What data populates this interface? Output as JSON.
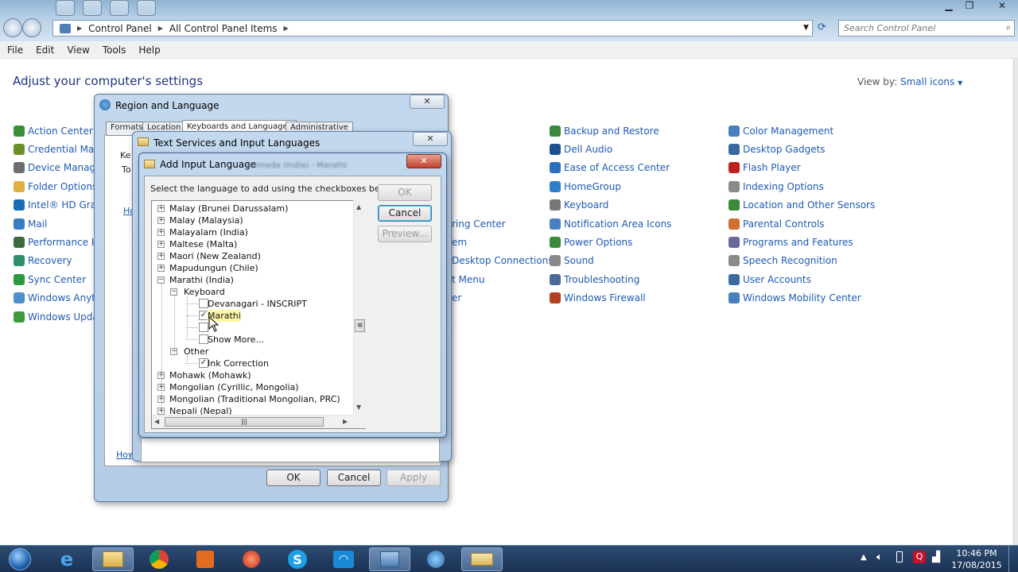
{
  "explorer": {
    "address": [
      "Control Panel",
      "All Control Panel Items"
    ],
    "search_placeholder": "Search Control Panel",
    "menu": [
      "File",
      "Edit",
      "View",
      "Tools",
      "Help"
    ],
    "title": "Adjust your computer's settings",
    "view_by_label": "View by:",
    "view_by_value": "Small icons",
    "col1": [
      {
        "label": "Action Center",
        "color": "#3c8c3c"
      },
      {
        "label": "Credential Mana",
        "color": "#6b8f2a"
      },
      {
        "label": "Device Manager",
        "color": "#6d6d6d"
      },
      {
        "label": "Folder Options",
        "color": "#e0b040"
      },
      {
        "label": "Intel® HD Graph",
        "color": "#1a6db5"
      },
      {
        "label": "Mail",
        "color": "#3b7dc4"
      },
      {
        "label": "Performance Info",
        "color": "#3a6b3a"
      },
      {
        "label": "Recovery",
        "color": "#2f8f6f"
      },
      {
        "label": "Sync Center",
        "color": "#2b9a3c"
      },
      {
        "label": "Windows Anytim",
        "color": "#4f8fcf"
      },
      {
        "label": "Windows Update",
        "color": "#3e9a3e"
      }
    ],
    "col2": [
      {
        "label": "ring Center"
      },
      {
        "label": "em"
      },
      {
        "label": "Desktop Connections"
      },
      {
        "label": "t Menu"
      },
      {
        "label": "er"
      }
    ],
    "col3": [
      {
        "label": "Backup and Restore",
        "color": "#3a8a3a"
      },
      {
        "label": "Dell Audio",
        "color": "#1e4f8f"
      },
      {
        "label": "Ease of Access Center",
        "color": "#2f6fbf"
      },
      {
        "label": "HomeGroup",
        "color": "#2f7fcf"
      },
      {
        "label": "Keyboard",
        "color": "#777777"
      },
      {
        "label": "Notification Area Icons",
        "color": "#4a7fbf"
      },
      {
        "label": "Power Options",
        "color": "#3a8a3a"
      },
      {
        "label": "Sound",
        "color": "#8a8a8a"
      },
      {
        "label": "Troubleshooting",
        "color": "#4a6a9a"
      },
      {
        "label": "Windows Firewall",
        "color": "#b04020"
      }
    ],
    "col4": [
      {
        "label": "Color Management",
        "color": "#4a7fbf"
      },
      {
        "label": "Desktop Gadgets",
        "color": "#3a6aa0"
      },
      {
        "label": "Flash Player",
        "color": "#c02020"
      },
      {
        "label": "Indexing Options",
        "color": "#8a8a8a"
      },
      {
        "label": "Location and Other Sensors",
        "color": "#3a8a3a"
      },
      {
        "label": "Parental Controls",
        "color": "#d07030"
      },
      {
        "label": "Programs and Features",
        "color": "#6a6a9a"
      },
      {
        "label": "Speech Recognition",
        "color": "#8a8a8a"
      },
      {
        "label": "User Accounts",
        "color": "#3a6aa0"
      },
      {
        "label": "Windows Mobility Center",
        "color": "#4a7fbf"
      }
    ]
  },
  "region_dialog": {
    "title": "Region and Language",
    "tabs": [
      "Formats",
      "Location",
      "Keyboards and Languages",
      "Administrative"
    ],
    "partial_texts": [
      "Ke",
      "To",
      "Ho",
      "How"
    ],
    "buttons": {
      "ok": "OK",
      "cancel": "Cancel",
      "apply": "Apply"
    }
  },
  "text_services_dialog": {
    "title": "Text Services and Input Languages",
    "blurred_text": "Kannada (India) - Marathi"
  },
  "add_lang_dialog": {
    "title": "Add Input Language",
    "instruction": "Select the language to add using the checkboxes below.",
    "buttons": {
      "ok": "OK",
      "cancel": "Cancel",
      "preview": "Preview..."
    },
    "tree": [
      {
        "label": "Malay (Brunei Darussalam)",
        "level": 0,
        "expander": "+"
      },
      {
        "label": "Malay (Malaysia)",
        "level": 0,
        "expander": "+"
      },
      {
        "label": "Malayalam (India)",
        "level": 0,
        "expander": "+"
      },
      {
        "label": "Maltese (Malta)",
        "level": 0,
        "expander": "+"
      },
      {
        "label": "Maori (New Zealand)",
        "level": 0,
        "expander": "+"
      },
      {
        "label": "Mapudungun (Chile)",
        "level": 0,
        "expander": "+"
      },
      {
        "label": "Marathi (India)",
        "level": 0,
        "expander": "-"
      },
      {
        "label": "Keyboard",
        "level": 1,
        "expander": "-"
      },
      {
        "label": "Devanagari - INSCRIPT",
        "level": 2,
        "checked": false
      },
      {
        "label": "Marathi",
        "level": 2,
        "checked": true
      },
      {
        "label": "",
        "level": 2,
        "checked": false
      },
      {
        "label": "Show More...",
        "level": 2,
        "checked": false
      },
      {
        "label": "Other",
        "level": 1,
        "expander": "-"
      },
      {
        "label": "Ink Correction",
        "level": 2,
        "checked": true
      },
      {
        "label": "Mohawk (Mohawk)",
        "level": 0,
        "expander": "+"
      },
      {
        "label": "Mongolian (Cyrillic, Mongolia)",
        "level": 0,
        "expander": "+"
      },
      {
        "label": "Mongolian (Traditional Mongolian, PRC)",
        "level": 0,
        "expander": "+"
      },
      {
        "label": "Nepali (Nepal)",
        "level": 0,
        "expander": "+"
      }
    ]
  },
  "taskbar": {
    "time": "10:46 PM",
    "date": "17/08/2015"
  }
}
